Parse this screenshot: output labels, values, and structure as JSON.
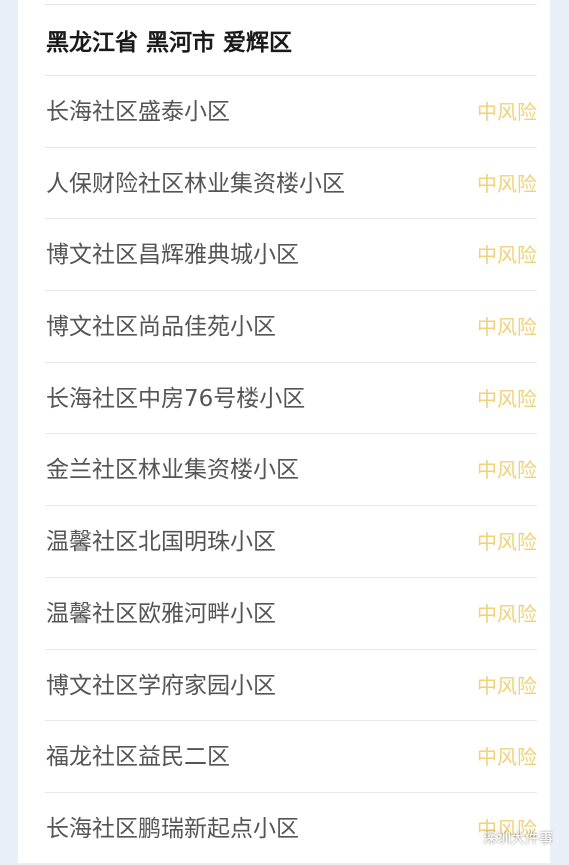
{
  "region": {
    "title": "黑龙江省 黑河市 爱辉区"
  },
  "communities": [
    {
      "name": "长海社区盛泰小区",
      "risk": "中风险"
    },
    {
      "name": "人保财险社区林业集资楼小区",
      "risk": "中风险"
    },
    {
      "name": "博文社区昌辉雅典城小区",
      "risk": "中风险"
    },
    {
      "name": "博文社区尚品佳苑小区",
      "risk": "中风险"
    },
    {
      "name": "长海社区中房76号楼小区",
      "risk": "中风险"
    },
    {
      "name": "金兰社区林业集资楼小区",
      "risk": "中风险"
    },
    {
      "name": "温馨社区北国明珠小区",
      "risk": "中风险"
    },
    {
      "name": "温馨社区欧雅河畔小区",
      "risk": "中风险"
    },
    {
      "name": "博文社区学府家园小区",
      "risk": "中风险"
    },
    {
      "name": "福龙社区益民二区",
      "risk": "中风险"
    },
    {
      "name": "长海社区鹏瑞新起点小区",
      "risk": "中风险"
    }
  ],
  "watermark": {
    "icon": "wechat-icon",
    "text": "深圳大件事"
  },
  "colors": {
    "risk_medium": "#f0d27a",
    "background": "#e9eff7",
    "card": "#ffffff"
  }
}
